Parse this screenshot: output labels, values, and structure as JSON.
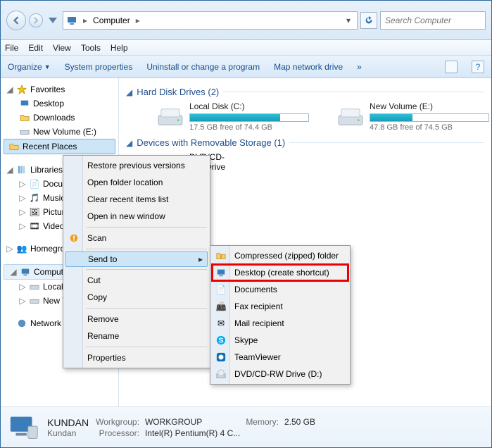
{
  "window": {
    "title": "Computer"
  },
  "addressbar": {
    "root_label": "Computer"
  },
  "search": {
    "placeholder": "Search Computer"
  },
  "menubar": [
    "File",
    "Edit",
    "View",
    "Tools",
    "Help"
  ],
  "toolbar": {
    "organize": "Organize",
    "sysprops": "System properties",
    "uninstall": "Uninstall or change a program",
    "mapdrive": "Map network drive",
    "overflow": "»"
  },
  "sidebar": {
    "favorites": {
      "label": "Favorites",
      "items": [
        "Desktop",
        "Downloads",
        "New Volume (E:)",
        "Recent Places"
      ]
    },
    "libraries": {
      "label": "Libraries",
      "items": [
        "Documents",
        "Music",
        "Pictures",
        "Videos"
      ]
    },
    "homegroup": {
      "label": "Homegroup"
    },
    "computer": {
      "label": "Computer",
      "items": [
        "Local Disk (C:)",
        "New Volume (E:)"
      ]
    },
    "network": {
      "label": "Network"
    }
  },
  "content": {
    "hdd_header": "Hard Disk Drives (2)",
    "removable_header": "Devices with Removable Storage (1)",
    "drives": [
      {
        "name": "Local Disk (C:)",
        "free": "17.5 GB free of 74.4 GB",
        "fill_pct": 76
      },
      {
        "name": "New Volume (E:)",
        "free": "47.8 GB free of 74.5 GB",
        "fill_pct": 36
      }
    ],
    "removable_item": "DVD/CD-RW Drive (D:)"
  },
  "ctx_main": [
    "Restore previous versions",
    "Open folder location",
    "Clear recent items list",
    "Open in new window",
    "__sep",
    "Scan",
    "__sep",
    "Send to",
    "__sep",
    "Cut",
    "Copy",
    "__sep",
    "Remove",
    "Rename",
    "__sep",
    "Properties"
  ],
  "ctx_sub": [
    "Compressed (zipped) folder",
    "Desktop (create shortcut)",
    "Documents",
    "Fax recipient",
    "Mail recipient",
    "Skype",
    "TeamViewer",
    "DVD/CD-RW Drive (D:)"
  ],
  "details": {
    "name": "KUNDAN",
    "sub": "Kundan",
    "workgroup_l": "Workgroup:",
    "workgroup_v": "WORKGROUP",
    "processor_l": "Processor:",
    "processor_v": "Intel(R) Pentium(R) 4 C...",
    "memory_l": "Memory:",
    "memory_v": "2.50 GB"
  }
}
